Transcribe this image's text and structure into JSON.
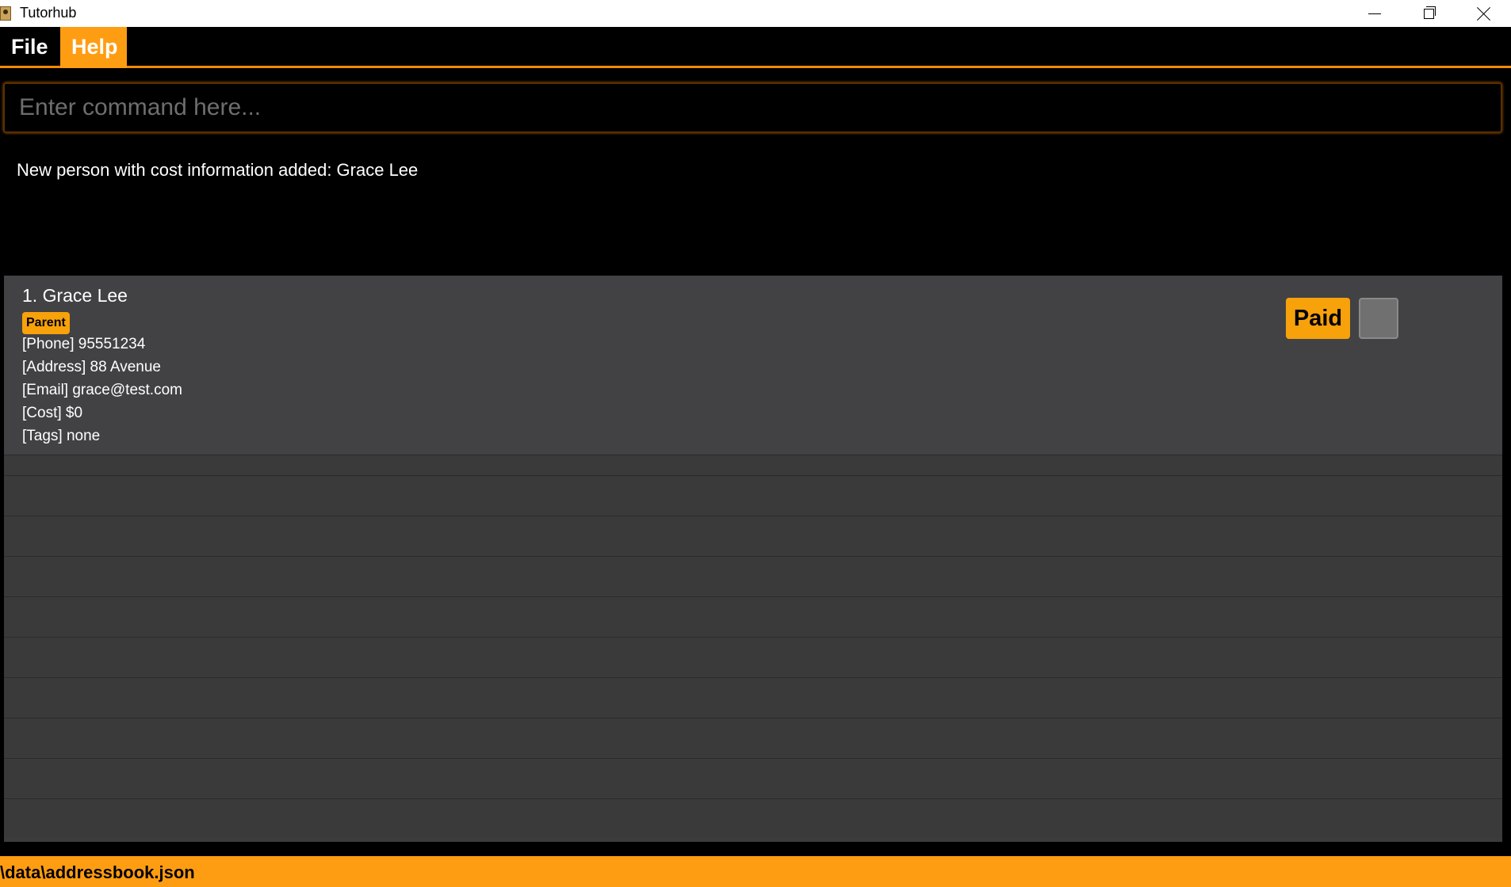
{
  "window": {
    "title": "Tutorhub"
  },
  "menu": {
    "items": [
      {
        "label": "File"
      },
      {
        "label": "Help"
      }
    ]
  },
  "command": {
    "placeholder": "Enter command here...",
    "value": ""
  },
  "result": {
    "message": "New person with cost information added: Grace Lee"
  },
  "persons": [
    {
      "index_name": "1. Grace Lee",
      "role": "Parent",
      "phone": "[Phone] 95551234",
      "address": "[Address] 88 Avenue",
      "email": "[Email] grace@test.com",
      "cost": "[Cost] $0",
      "tags": "[Tags] none",
      "paid_label": "Paid",
      "paid_checked": false
    }
  ],
  "status": {
    "path": "\\data\\addressbook.json"
  },
  "colors": {
    "accent": "#ff9d12",
    "background": "#000000",
    "card": "#424244"
  }
}
